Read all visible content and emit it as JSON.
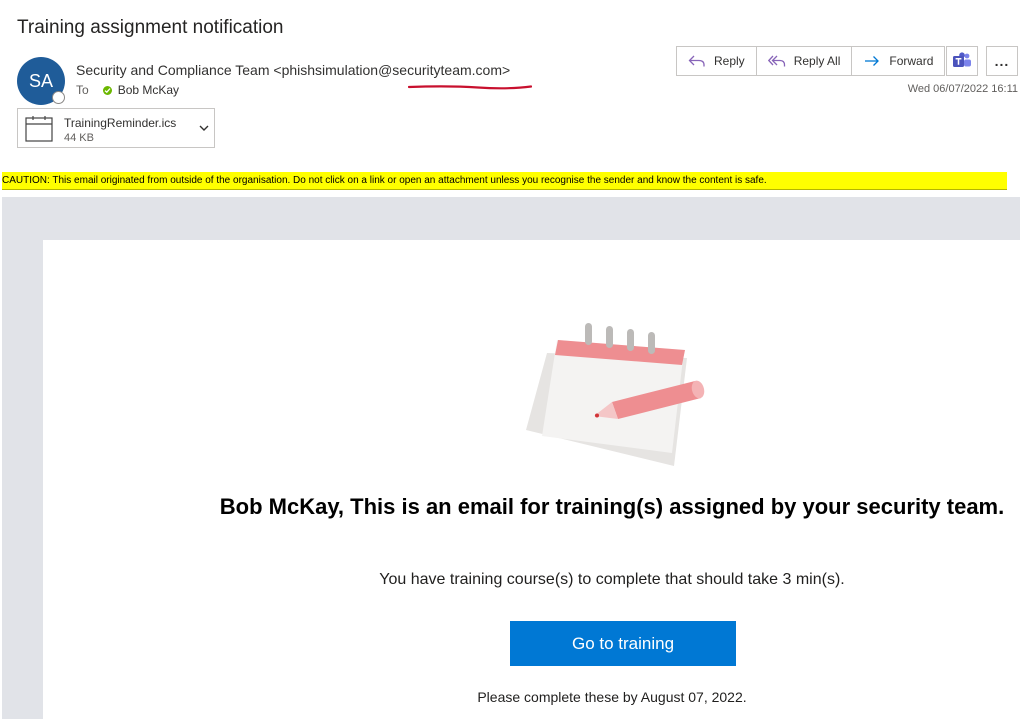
{
  "email": {
    "subject": "Training assignment notification",
    "avatar_initials": "SA",
    "sender": "Security and Compliance Team <phishsimulation@securityteam.com>",
    "to_label": "To",
    "recipient": "Bob McKay",
    "datetime": "Wed 06/07/2022 16:11"
  },
  "attachment": {
    "name": "TrainingReminder.ics",
    "size": "44 KB"
  },
  "toolbar": {
    "reply": "Reply",
    "reply_all": "Reply All",
    "forward": "Forward",
    "more": "..."
  },
  "caution": "CAUTION: This email originated from outside of the organisation. Do not click on a link or open an attachment unless you recognise the sender and know the content is safe.",
  "body": {
    "heading": "Bob McKay, This is an email for training(s) assigned by your security team.",
    "description": "You have training course(s) to complete that should take 3 min(s).",
    "cta": "Go to training",
    "deadline": "Please complete these by August 07, 2022."
  },
  "colors": {
    "accent": "#0078d4",
    "avatar": "#1f5c99",
    "caution_bg": "#ffff00",
    "underline_annotation": "#c8102e"
  },
  "icons": {
    "reply": "reply-arrow-icon",
    "reply_all": "reply-all-arrow-icon",
    "forward": "forward-arrow-icon",
    "teams": "teams-icon",
    "attachment": "calendar-icon"
  }
}
